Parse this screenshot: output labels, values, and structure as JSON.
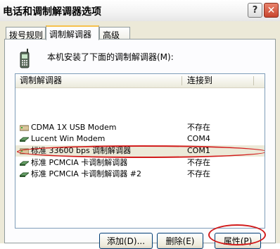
{
  "window": {
    "title": "电话和调制解调器选项"
  },
  "tabs": [
    "拨号规则",
    "调制解调器",
    "高级"
  ],
  "intro": "本机安装了下面的调制解调器(M):",
  "list": {
    "columns": [
      "调制解调器",
      "连接到"
    ],
    "rows": [
      {
        "name": "CDMA 1X USB Modem",
        "port": "不存在",
        "icon": "modem-icon"
      },
      {
        "name": "Lucent Win Modem",
        "port": "COM4",
        "icon": "modem-icon"
      },
      {
        "name": "标准 33600 bps 调制解调器",
        "port": "COM1",
        "icon": "modem-icon",
        "selected": true
      },
      {
        "name": "标准 PCMCIA 卡调制解调器",
        "port": "不存在",
        "icon": "pcmcia-card-icon"
      },
      {
        "name": "标准 PCMCIA 卡调制解调器 #2",
        "port": "不存在",
        "icon": "pcmcia-card-icon"
      }
    ]
  },
  "buttons": {
    "add": "添加(D)...",
    "remove": "删除(E)",
    "properties": "属性(P)"
  },
  "colors": {
    "annotation": "#d21c1c",
    "active_tab_accent": "#f6c14c"
  }
}
